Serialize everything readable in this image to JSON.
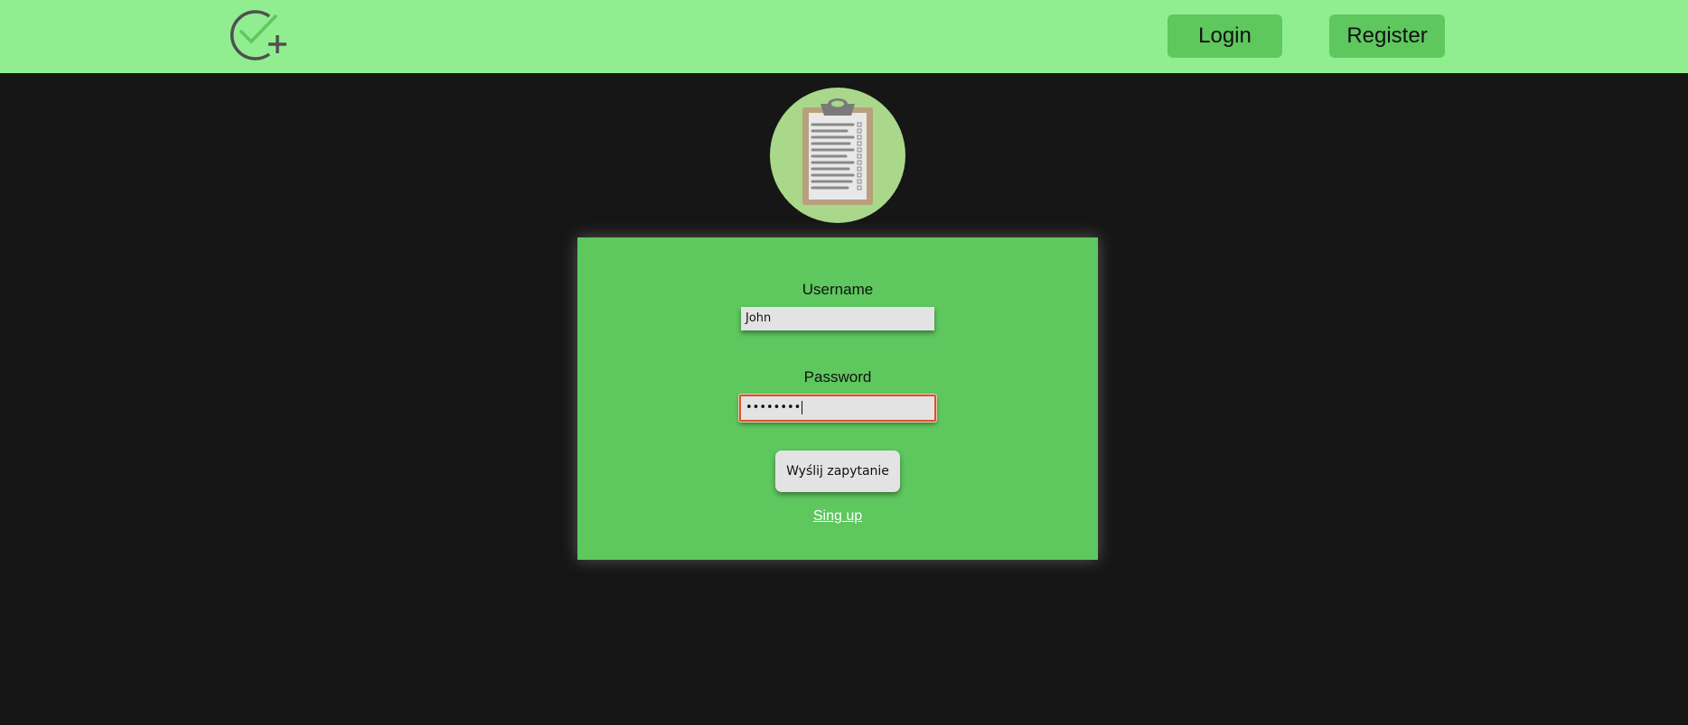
{
  "header": {
    "logo_icon": "check-plus-icon",
    "login_label": "Login",
    "register_label": "Register"
  },
  "avatar": {
    "icon": "clipboard-checklist-icon"
  },
  "form": {
    "username_label": "Username",
    "username_value": "John",
    "password_label": "Password",
    "password_masked": "••••••••",
    "submit_label": "Wyślij zapytanie",
    "signup_link": "Sing up"
  },
  "colors": {
    "navbar": "#90ee90",
    "button": "#5ec75e",
    "background": "#161616",
    "card": "#5ec75e",
    "avatar_bg": "#a9d88b",
    "focus_border": "#d4542a"
  }
}
